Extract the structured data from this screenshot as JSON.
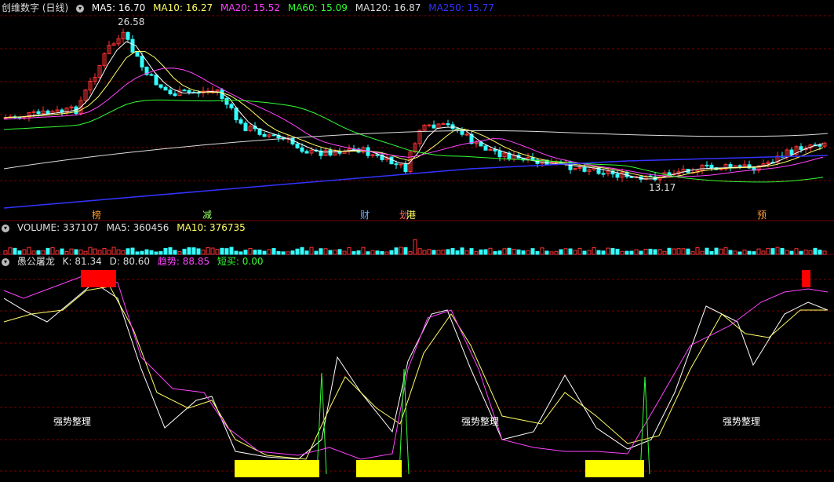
{
  "main": {
    "title": "创维数字 (日线)",
    "ma": [
      {
        "label": "MA5: 16.70",
        "color": "#ffffff"
      },
      {
        "label": "MA10: 16.27",
        "color": "#ffff66"
      },
      {
        "label": "MA20: 15.52",
        "color": "#ff44ff"
      },
      {
        "label": "MA60: 15.09",
        "color": "#33ff33"
      },
      {
        "label": "MA120: 16.87",
        "color": "#dddddd"
      },
      {
        "label": "MA250: 15.77",
        "color": "#3333ff"
      }
    ],
    "high_marker": "26.58",
    "low_marker": "13.17",
    "events": [
      "榜",
      "减",
      "财",
      "划",
      "港",
      "预"
    ]
  },
  "volume": {
    "label": "VOLUME: 337107",
    "ma5": "MA5: 360456",
    "ma10": "MA10: 376735"
  },
  "indicator": {
    "name": "愚公屠龙",
    "k": "K: 81.34",
    "d": "D: 80.60",
    "trend": "趋势: 88.85",
    "short": "短买: 0.00",
    "notes": [
      "强势整理",
      "强势整理",
      "强势整理"
    ]
  },
  "colors": {
    "up": "#ff3333",
    "down": "#33ffff",
    "grid": "#7a0000"
  }
}
